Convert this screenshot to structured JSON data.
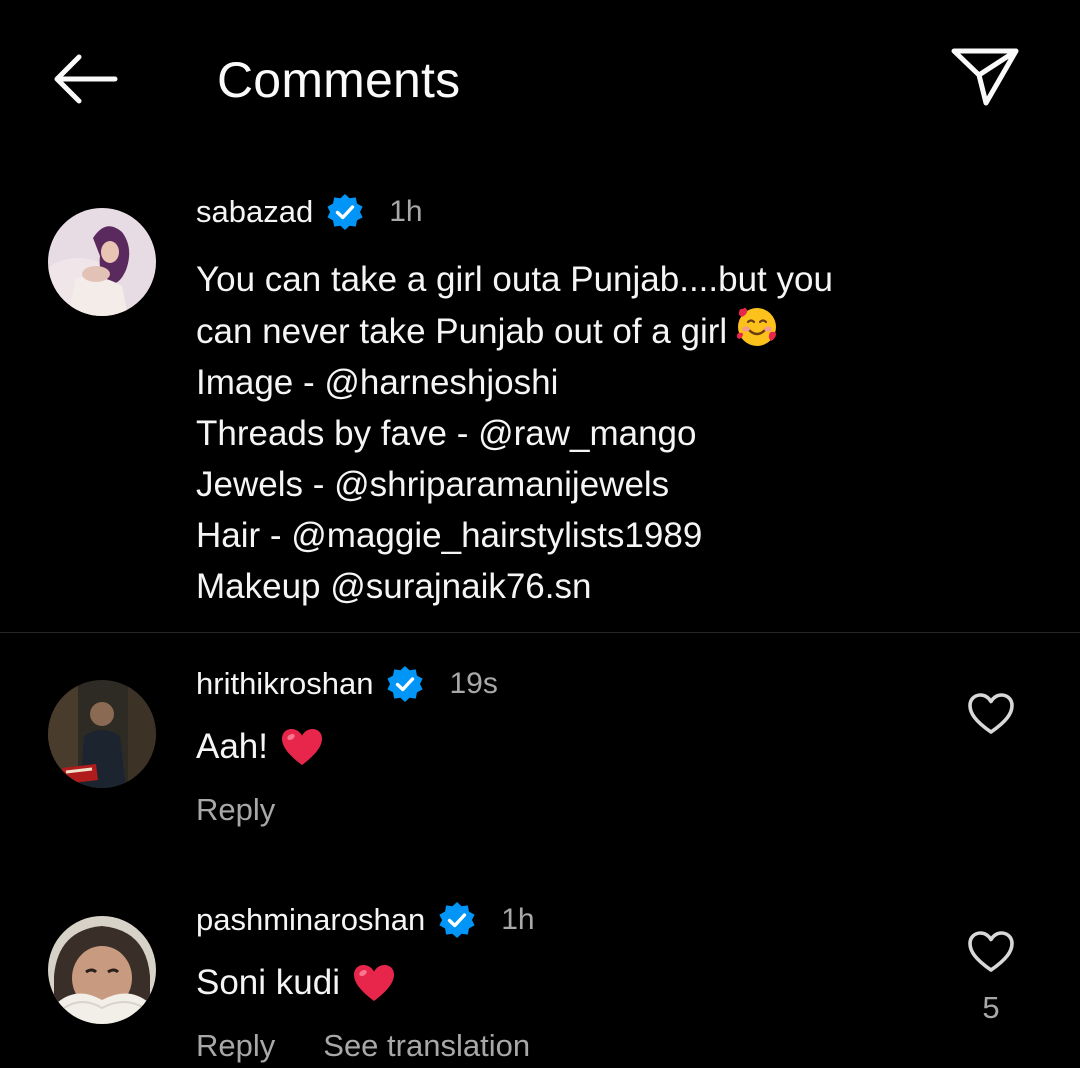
{
  "header": {
    "title": "Comments",
    "back_icon": "arrow-left-icon",
    "share_icon": "paper-plane-icon"
  },
  "caption": {
    "username": "sabazad",
    "verified": true,
    "time": "1h",
    "lines": [
      "You can take a girl outa Punjab....but you",
      "can never take Punjab out of a girl",
      "Image - @harneshjoshi",
      "Threads by fave - @raw_mango",
      "Jewels - @shriparamanijewels",
      "Hair - @maggie_hairstylists1989",
      "Makeup @surajnaik76.sn"
    ],
    "emoji": "smiling-face-with-hearts"
  },
  "comments": [
    {
      "username": "hrithikroshan",
      "verified": true,
      "time": "19s",
      "text": "Aah!",
      "emoji": "red-heart",
      "reply_label": "Reply",
      "like_count": ""
    },
    {
      "username": "pashminaroshan",
      "verified": true,
      "time": "1h",
      "text": "Soni kudi",
      "emoji": "red-heart",
      "reply_label": "Reply",
      "translation_label": "See translation",
      "like_count": "5"
    }
  ],
  "colors": {
    "background": "#000000",
    "primary_text": "#f5f5f5",
    "secondary_text": "#a8a8a8",
    "verified_blue": "#0095f6",
    "divider": "#262626",
    "heart_red": "#e0245e"
  }
}
